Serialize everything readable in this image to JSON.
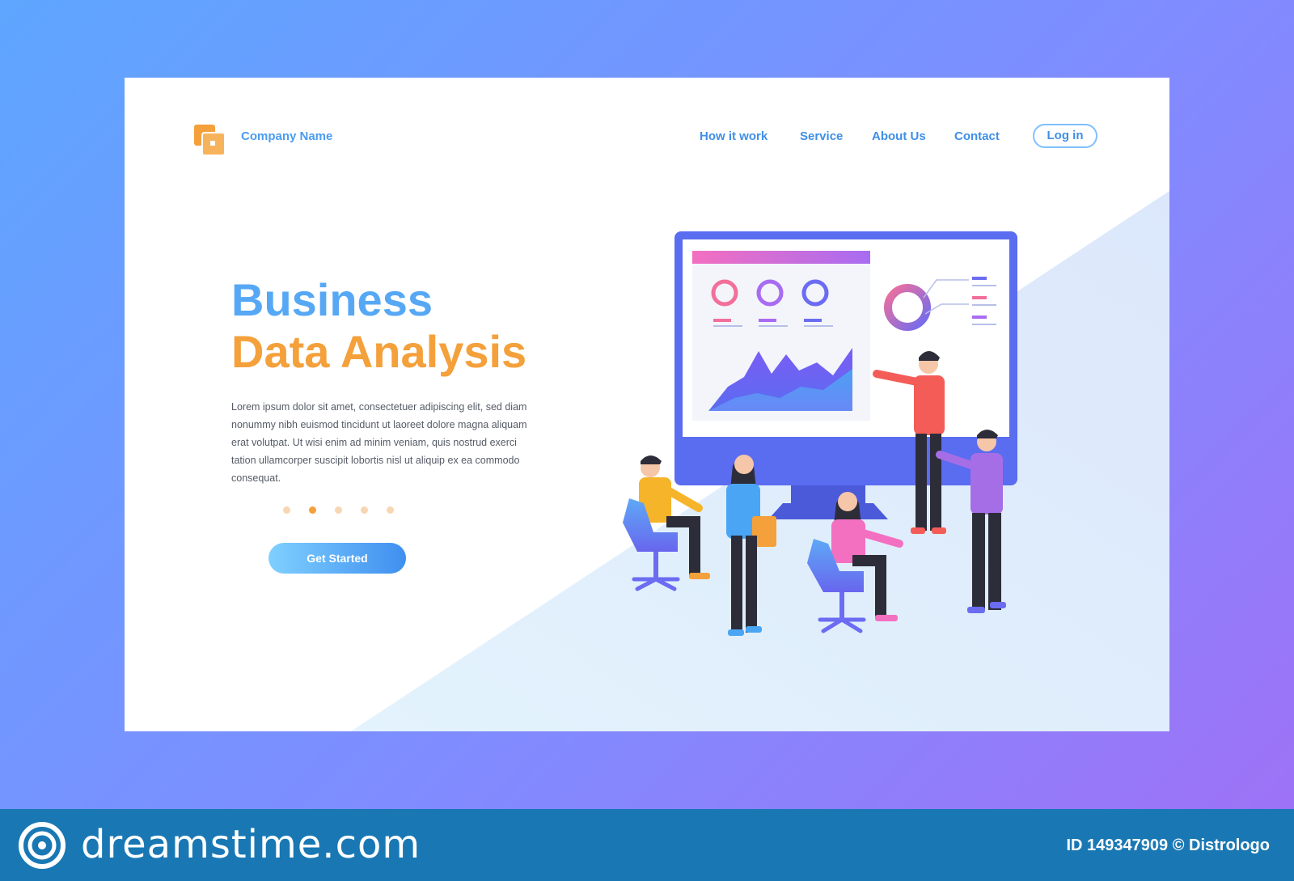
{
  "header": {
    "company_name": "Company Name",
    "nav": [
      "How it work",
      "Service",
      "About Us",
      "Contact"
    ],
    "login_label": "Log in"
  },
  "hero": {
    "title_line1": "Business",
    "title_line2": "Data Analysis",
    "body": "Lorem ipsum dolor sit amet, consectetuer adipiscing elit, sed diam nonummy nibh euismod tincidunt ut laoreet dolore magna aliquam erat volutpat. Ut wisi enim ad minim veniam, quis nostrud exerci tation ullamcorper suscipit lobortis nisl ut aliquip ex ea commodo consequat.",
    "cta_label": "Get Started",
    "slider": {
      "count": 5,
      "active_index": 1
    }
  },
  "footer": {
    "brand": "dreamstime.com",
    "id_text": "ID 149347909 © Distrologo"
  },
  "colors": {
    "primary_blue": "#56a8f5",
    "accent_orange": "#f4a03b",
    "footer_blue": "#1978b4"
  }
}
